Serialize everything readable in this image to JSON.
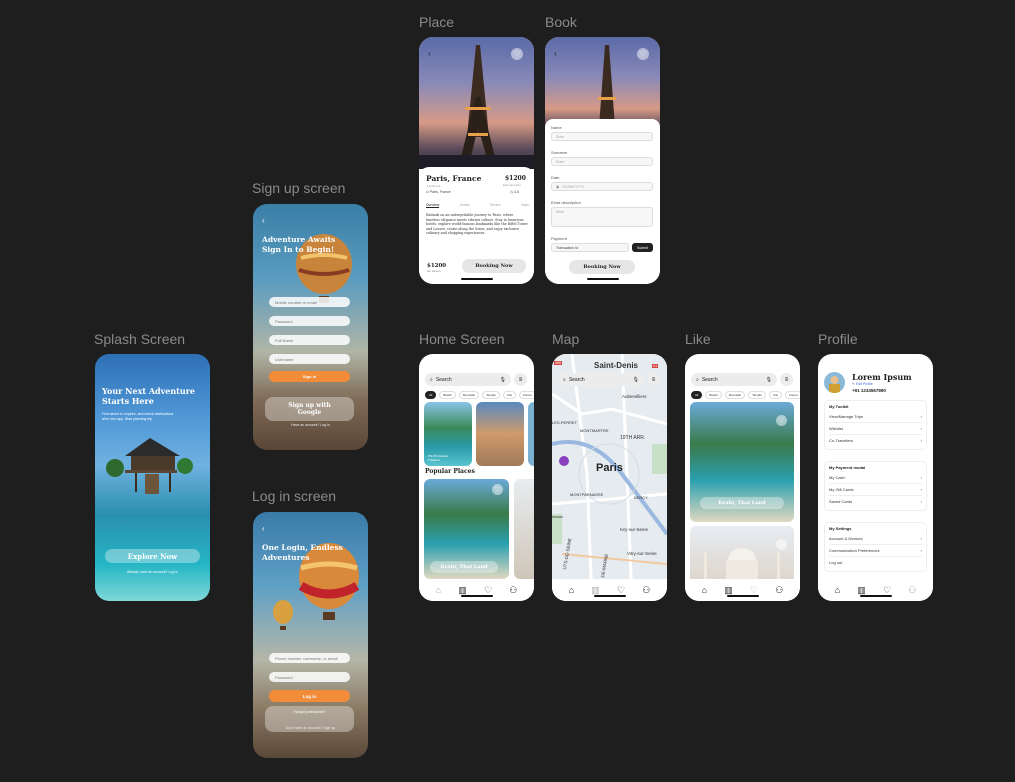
{
  "frames": {
    "splash": "Splash Screen",
    "signup": "Sign up screen",
    "login": "Log in screen",
    "place": "Place",
    "book": "Book",
    "home": "Home Screen",
    "map": "Map",
    "like": "Like",
    "profile": "Profile"
  },
  "splash": {
    "title": "Your Next Adventure Starts Here",
    "subtitle": "Find where to explore, and check destinations all in one app. Start planning trip",
    "cta": "Explore Now",
    "footer": "Already have an account? Log in"
  },
  "signup": {
    "heading": "Adventure Awaits Sign In to Begin!",
    "fields": [
      "Mobile number or email",
      "Password",
      "Full Name",
      "Username"
    ],
    "submit": "Sign in",
    "google": "Sign up with Google",
    "footer": "Have an account? Log in"
  },
  "login": {
    "heading": "One Login, Endless Adventures",
    "fields": [
      "Phone number, username, or email",
      "Password"
    ],
    "submit": "Log in",
    "forgot": "Forgot password?",
    "footer": "Don't have an account? Sign up"
  },
  "place": {
    "name": "Paris, France",
    "price": "$1200",
    "price_note": "Estimated fare",
    "location": "Paris, France",
    "rating": "4.5",
    "badge": "Landmark",
    "tabs": [
      "Overview",
      "Details",
      "Review",
      "Maps"
    ],
    "description": "Embark on an unforgettable journey to Paris, where timeless elegance meets vibrant culture. Stay in luxurious hotels, explore world-famous landmarks like the Eiffel Tower and Louvre, cruise along the Seine, and enjoy exclusive culinary and shopping experiences.",
    "footer_price": "$1200",
    "footer_unit": "per person",
    "cta": "Booking Now"
  },
  "book": {
    "labels": [
      "Name",
      "Surname",
      "Date",
      "Extra description",
      "Payment"
    ],
    "placeholders": [
      "Enter",
      "Enter",
      "DD/MM/YYYY",
      "Write"
    ],
    "payment_value": "Transaction Id",
    "submit": "Submit",
    "cta": "Booking Now"
  },
  "home": {
    "search": "Search",
    "chips": [
      "All",
      "Beach",
      "Mountain",
      "Temple",
      "City",
      "Forest"
    ],
    "card_label": "Phi Phi Islands, Thailand",
    "section": "Popular Places",
    "popular_label": "Krabi, Thai Land"
  },
  "map": {
    "search": "Search",
    "labels": {
      "city": "Paris",
      "north": "Saint-Denis",
      "ne": "Aubervilliers",
      "w": "Puteaux",
      "montmartre": "MONTMARTRE",
      "arr": "19TH ARR.",
      "montparnasse": "MONTPARNASSE",
      "bercy": "BERCY",
      "ivry": "Ivry-sur-Seine",
      "vitry": "Vitry-sur-Seine",
      "ss": "LES-PERRET",
      "sw": "UTS-DE-SEINE",
      "sw2": "DE-MARNE",
      "neu": "neaux",
      "a1": "A1",
      "a86": "A86"
    }
  },
  "like": {
    "search": "Search",
    "chips": [
      "All",
      "Beach",
      "Mountain",
      "Temple",
      "City",
      "Forest"
    ],
    "card_label": "Krabi, Thai Land"
  },
  "profile": {
    "name": "Lorem Ipsum",
    "edit": "Edit Profile",
    "phone": "+91 1234567890",
    "sections": [
      {
        "title": "My Toolkit",
        "items": [
          "View/Manage Trips",
          "Wishlist",
          "Co-Travellers"
        ]
      },
      {
        "title": "My Payment modal",
        "items": [
          "My Cash",
          "My Gift Cards",
          "Saved Cards"
        ]
      },
      {
        "title": "My Settings",
        "items": [
          "Account & Devices",
          "Communication Preferences",
          "Log out"
        ]
      }
    ]
  },
  "colors": {
    "background": "#1e1e1e",
    "accent": "#f28c38",
    "dark": "#222222"
  }
}
